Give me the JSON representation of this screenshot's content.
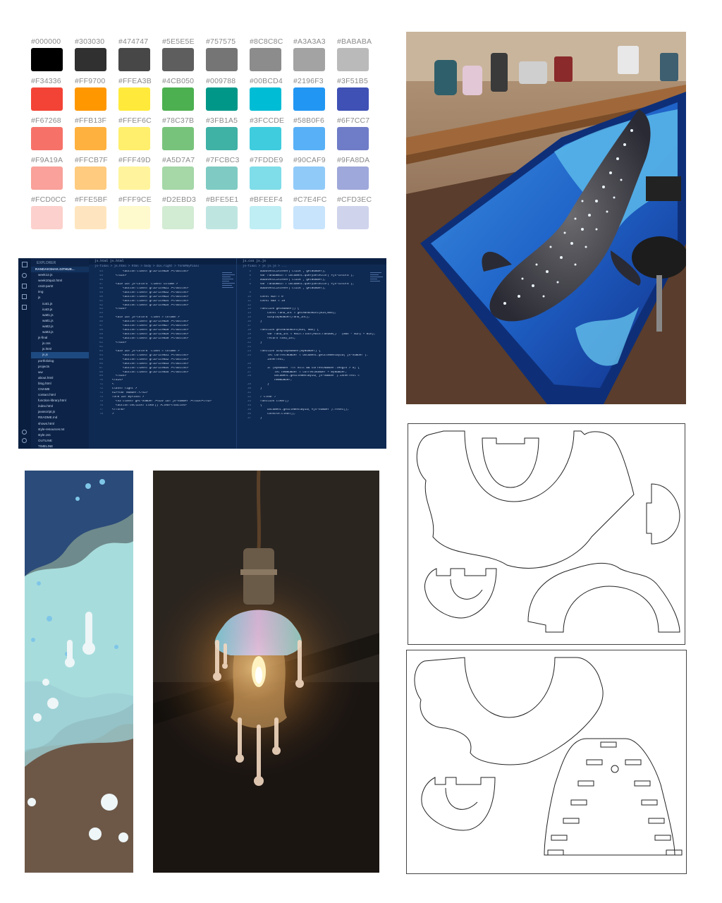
{
  "palette": {
    "rows": [
      [
        {
          "label": "#000000",
          "color": "#000000"
        },
        {
          "label": "#303030",
          "color": "#303030"
        },
        {
          "label": "#474747",
          "color": "#474747"
        },
        {
          "label": "#5E5E5E",
          "color": "#5E5E5E"
        },
        {
          "label": "#757575",
          "color": "#757575"
        },
        {
          "label": "#8C8C8C",
          "color": "#8C8C8C"
        },
        {
          "label": "#A3A3A3",
          "color": "#A3A3A3"
        },
        {
          "label": "#BABABA",
          "color": "#BABABA"
        }
      ],
      [
        {
          "label": "#F34336",
          "color": "#F34336"
        },
        {
          "label": "#FF9700",
          "color": "#FF9700"
        },
        {
          "label": "#FFEA3B",
          "color": "#FFEA3B"
        },
        {
          "label": "#4CB050",
          "color": "#4CB050"
        },
        {
          "label": "#009788",
          "color": "#009788"
        },
        {
          "label": "#00BCD4",
          "color": "#00BCD4"
        },
        {
          "label": "#2196F3",
          "color": "#2196F3"
        },
        {
          "label": "#3F51B5",
          "color": "#3F51B5"
        }
      ],
      [
        {
          "label": "#F67268",
          "color": "#F67268"
        },
        {
          "label": "#FFB13F",
          "color": "#FFB13F"
        },
        {
          "label": "#FFEF6C",
          "color": "#FFEF6C"
        },
        {
          "label": "#78C37B",
          "color": "#78C37B"
        },
        {
          "label": "#3FB1A5",
          "color": "#3FB1A5"
        },
        {
          "label": "#3FCCDE",
          "color": "#3FCCDE"
        },
        {
          "label": "#58B0F6",
          "color": "#58B0F6"
        },
        {
          "label": "#6F7CC7",
          "color": "#6F7CC7"
        }
      ],
      [
        {
          "label": "#F9A19A",
          "color": "#F9A19A"
        },
        {
          "label": "#FFCB7F",
          "color": "#FFCB7F"
        },
        {
          "label": "#FFF49D",
          "color": "#FFF49D"
        },
        {
          "label": "#A5D7A7",
          "color": "#A5D7A7"
        },
        {
          "label": "#7FCBC3",
          "color": "#7FCBC3"
        },
        {
          "label": "#7FDDE9",
          "color": "#7FDDE9"
        },
        {
          "label": "#90CAF9",
          "color": "#90CAF9"
        },
        {
          "label": "#9FA8DA",
          "color": "#9FA8DA"
        }
      ],
      [
        {
          "label": "#FCD0CC",
          "color": "#FCD0CC"
        },
        {
          "label": "#FFE5BF",
          "color": "#FFE5BF"
        },
        {
          "label": "#FFF9CE",
          "color": "#FFF9CE"
        },
        {
          "label": "#D2EBD3",
          "color": "#D2EBD3"
        },
        {
          "label": "#BFE5E1",
          "color": "#BFE5E1"
        },
        {
          "label": "#BFEEF4",
          "color": "#BFEEF4"
        },
        {
          "label": "#C7E4FC",
          "color": "#C7E4FC"
        },
        {
          "label": "#CFD3EC",
          "color": "#CFD3EC"
        }
      ]
    ]
  },
  "code": {
    "explorer_title": "EXPLORER",
    "explorer_root": "RANDAKSHAK.GITHUB...",
    "files": [
      "week12.js",
      "week10quiz.html",
      "css3-part2",
      "img",
      "js",
      "icat1.js",
      "icat3.js",
      "watt1.js",
      "watt1.js",
      "watt2.js",
      "watt3.js",
      "js-final",
      "js.css",
      "js.html",
      "js.js",
      "portfoliolog",
      "projects",
      "ww",
      "about.html",
      "blog.html",
      "CNAME",
      "contact.html",
      "function-library.html",
      "index.html",
      "javascript.js",
      "README.md",
      "shows.html",
      "style-resources.txt",
      "style.css",
      "OUTLINE",
      "TIMELINE"
    ],
    "left_tabs": "js.html    js.html",
    "left_crumb": "js-final > js.html > html > body > div.right > form#myFinal",
    "right_tabs": "js.css    js.js",
    "right_crumb": "js-final > js js.js > ...",
    "left_lines": [
      {
        "n": "44",
        "t": "        <button class=\"grid-item20\"></button>"
      },
      {
        "n": "45",
        "t": "    </div>"
      },
      {
        "n": "46",
        "t": ""
      },
      {
        "n": "47",
        "t": "    <div id=\"js-color4\" class=\"column\">"
      },
      {
        "n": "48",
        "t": "        <button class=\"grid-item21\"></button>"
      },
      {
        "n": "49",
        "t": "        <button class=\"grid-item22\"></button>"
      },
      {
        "n": "50",
        "t": "        <button class=\"grid-item23\"></button>"
      },
      {
        "n": "51",
        "t": "        <button class=\"grid-item24\"></button>"
      },
      {
        "n": "52",
        "t": "        <button class=\"grid-item25\"></button>"
      },
      {
        "n": "53",
        "t": "    </div>"
      },
      {
        "n": "54",
        "t": ""
      },
      {
        "n": "55",
        "t": "    <div id=\"js-color5\" class =\"column\">"
      },
      {
        "n": "56",
        "t": "        <button class=\"grid-item26\"></button>"
      },
      {
        "n": "57",
        "t": "        <button class=\"grid-item27\"></button>"
      },
      {
        "n": "58",
        "t": "        <button class=\"grid-item28\"></button>"
      },
      {
        "n": "59",
        "t": "        <button class=\"grid-item29\"></button>"
      },
      {
        "n": "60",
        "t": "        <button class=\"grid-item30\"></button>"
      },
      {
        "n": "61",
        "t": "    </div>"
      },
      {
        "n": "62",
        "t": ""
      },
      {
        "n": "63",
        "t": "    <div id=\"js-color6\" class =\"column\">"
      },
      {
        "n": "64",
        "t": "        <button class=\"grid-item31\"></button>"
      },
      {
        "n": "65",
        "t": "        <button class=\"grid-item32\"></button>"
      },
      {
        "n": "66",
        "t": "        <button class=\"grid-item33\"></button>"
      },
      {
        "n": "67",
        "t": "        <button class=\"grid-item34\"></button>"
      },
      {
        "n": "68",
        "t": "        <button class=\"grid-item35\"></button>"
      },
      {
        "n": "69",
        "t": "    </div>"
      },
      {
        "n": "70",
        "t": "  </div>"
      },
      {
        "n": "71",
        "t": "  <"
      },
      {
        "n": "72",
        "t": "  class=\"right\">"
      },
      {
        "n": "73",
        "t": "  h2>Your Number:</h2>"
      },
      {
        "n": "74",
        "t": "  form id=\"myFinal\">"
      },
      {
        "n": "75",
        "t": "    <h3 class=\"get-number\"><div id=\"js-number\"></div></h3>"
      },
      {
        "n": "76",
        "t": "    <button onclick=\"clear()\">Clear</button>"
      },
      {
        "n": "77",
        "t": "  </form>"
      },
      {
        "n": "78",
        "t": "  >"
      }
    ],
    "right_lines": [
      {
        "n": "5",
        "t": "  addEventListener('click', getNumber);"
      },
      {
        "n": "6",
        "t": "  var randomBtn = document.querySelector('#js-color5');"
      },
      {
        "n": "7",
        "t": "  addEventListener('click', getNumber);"
      },
      {
        "n": "8",
        "t": "  var randomBtn = document.querySelector('#js-color6');"
      },
      {
        "n": "",
        "t": "  addEventListener('click', getNumber);"
      },
      {
        "n": "9",
        "t": ""
      },
      {
        "n": "10",
        "t": "  const min = 0"
      },
      {
        "n": "11",
        "t": "  const max = 10"
      },
      {
        "n": "12",
        "t": ""
      },
      {
        "n": "13",
        "t": "  function getNumber() {"
      },
      {
        "n": "14",
        "t": "      const rand_int = getRandomInt(min,max);"
      },
      {
        "n": "15",
        "t": "      displayNumber(rand_int);"
      },
      {
        "n": "16",
        "t": "  }"
      },
      {
        "n": "17",
        "t": ""
      },
      {
        "n": "18",
        "t": "  function getRandomInt(min, max) {"
      },
      {
        "n": "19",
        "t": "      var rand_int = Math.floor(Math.random() * (max - min) + min);"
      },
      {
        "n": "20",
        "t": "      return rand_int;"
      },
      {
        "n": "21",
        "t": "  }"
      },
      {
        "n": "22",
        "t": ""
      },
      {
        "n": "23",
        "t": "  function displayNumber(myNumber) {"
      },
      {
        "n": "24",
        "t": "      let currentNumber = document.getElementById('js-number')."
      },
      {
        "n": "",
        "t": "      innerText;"
      },
      {
        "n": "25",
        "t": ""
      },
      {
        "n": "26",
        "t": "      if (myNumber !== null && currentNumber.length > 5) {"
      },
      {
        "n": "27",
        "t": "          let newNumber = currentNumber + myNumber;"
      },
      {
        "n": "28",
        "t": "          document.getElementById('js-number').innerText ="
      },
      {
        "n": "",
        "t": "          newNumber;"
      },
      {
        "n": "29",
        "t": "      }"
      },
      {
        "n": "30",
        "t": "  }"
      },
      {
        "n": "31",
        "t": ""
      },
      {
        "n": "32",
        "t": "  /*clear*/"
      },
      {
        "n": "33",
        "t": "  function clear()"
      },
      {
        "n": "34",
        "t": "  {"
      },
      {
        "n": "35",
        "t": "      document.getElementById(\"#js-number\").reset();"
      },
      {
        "n": "36",
        "t": "      console.clear();"
      },
      {
        "n": "37",
        "t": "  }"
      }
    ]
  }
}
